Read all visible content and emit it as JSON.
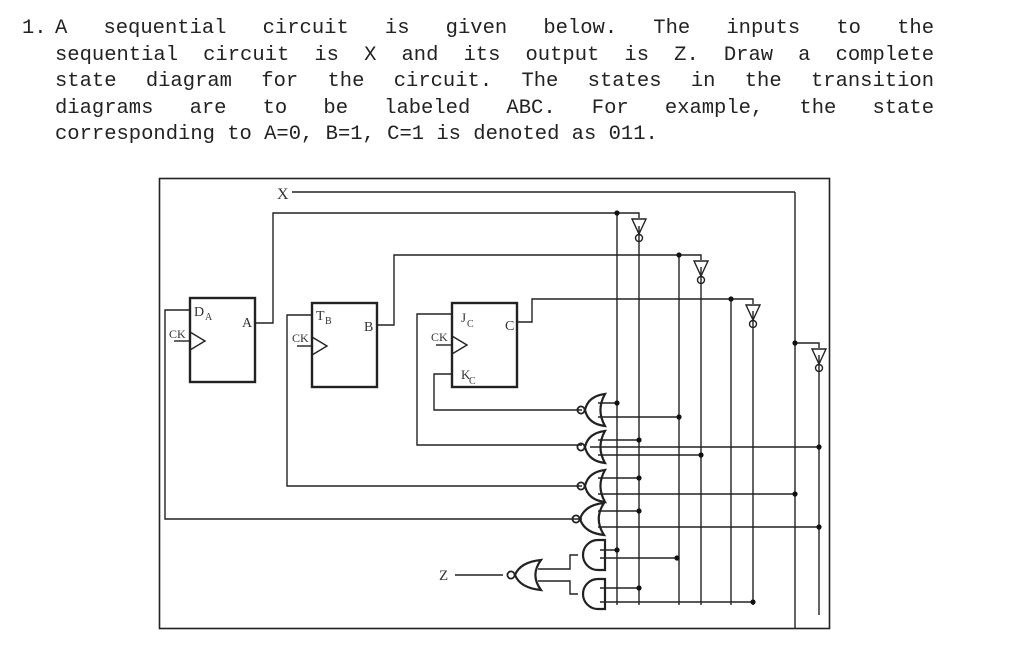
{
  "question": {
    "number": "1.",
    "lines": [
      "A  sequential  circuit  is  given  below.  The  inputs  to  the",
      "sequential circuit is X and its output is Z. Draw a complete",
      "state diagram for the circuit. The states in the transition",
      "diagrams  are  to  be  labeled  ABC.  For  example,  the  state",
      "corresponding to A=0, B=1, C=1 is denoted as 011."
    ]
  },
  "circuit": {
    "input_label": "X",
    "output_label": "Z",
    "flip_flops": [
      {
        "id": "A",
        "type": "D",
        "input_label": "D",
        "input_sub": "A",
        "clock_label": "CK",
        "output_label": "A"
      },
      {
        "id": "B",
        "type": "T",
        "input_label": "T",
        "input_sub": "B",
        "clock_label": "CK",
        "output_label": "B"
      },
      {
        "id": "C",
        "type": "JK",
        "input_label": "J",
        "input_sub": "C",
        "input2_label": "K",
        "input2_sub": "C",
        "clock_label": "CK",
        "output_label": "C"
      }
    ],
    "inverters": [
      "A'",
      "B'",
      "C'",
      "X'"
    ],
    "gates": [
      {
        "type": "NOR",
        "output": "K_C",
        "inputs": [
          "A",
          "B'"
        ]
      },
      {
        "type": "NOR",
        "output": "J_C",
        "inputs": [
          "A'",
          "X'",
          "C"
        ]
      },
      {
        "type": "NOR",
        "output": "T_B",
        "inputs": [
          "A'",
          "X"
        ]
      },
      {
        "type": "NOR",
        "output": "D_A",
        "inputs": [
          "A'",
          "X'"
        ]
      },
      {
        "type": "AND",
        "output": "Z_in1",
        "inputs": [
          "A",
          "B'"
        ]
      },
      {
        "type": "AND",
        "output": "Z_in2",
        "inputs": [
          "A'",
          "C'"
        ]
      },
      {
        "type": "NOR",
        "output": "Z",
        "inputs": [
          "Z_in1",
          "Z_in2"
        ]
      }
    ]
  }
}
